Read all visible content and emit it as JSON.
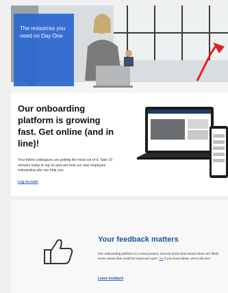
{
  "hero": {
    "title": "The resources you need on Day One"
  },
  "onboarding": {
    "heading": "Our onboarding platform is growing fast. Get online (and in line)!",
    "body": "Your fellow colleagues are getting the most out of it. Take 10 minutes today to log on and see how our new employee onboarding site can help you.",
    "link_label": "Log on now!"
  },
  "feedback": {
    "heading": "Your feedback matters",
    "body_part1": "Our onboarding platform is a new product, and we know that means there are likely some areas that could be improved upon.",
    "body_so": "So",
    "body_part2": " if you have ideas, we're all ears.",
    "link_label": "Leave feedback",
    "icon": "thumbs-up-icon"
  },
  "colors": {
    "accent": "#2f6ad1",
    "heading_blue": "#1d4fa8"
  }
}
